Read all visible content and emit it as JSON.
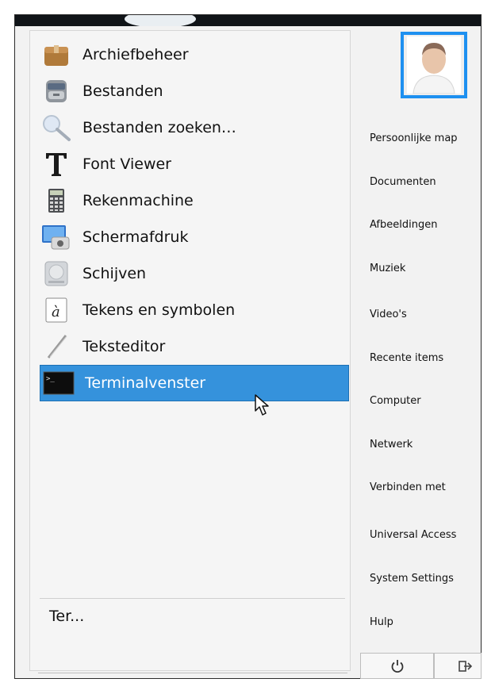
{
  "apps": [
    {
      "label": "Archiefbeheer",
      "icon": "archive-box-icon"
    },
    {
      "label": "Bestanden",
      "icon": "file-cabinet-icon"
    },
    {
      "label": "Bestanden zoeken…",
      "icon": "magnifier-icon"
    },
    {
      "label": "Font Viewer",
      "icon": "font-T-icon"
    },
    {
      "label": "Rekenmachine",
      "icon": "calculator-icon"
    },
    {
      "label": "Schermafdruk",
      "icon": "screenshot-icon"
    },
    {
      "label": "Schijven",
      "icon": "disk-icon"
    },
    {
      "label": "Tekens en symbolen",
      "icon": "character-map-icon"
    },
    {
      "label": "Teksteditor",
      "icon": "text-editor-icon"
    },
    {
      "label": "Terminalvenster",
      "icon": "terminal-icon",
      "selected": true
    }
  ],
  "search": {
    "value": "Ter..."
  },
  "places": [
    "Persoonlijke map",
    "Documenten",
    "Afbeeldingen",
    "Muziek",
    "Video's",
    "Recente items",
    "Computer",
    "Netwerk",
    "Verbinden met",
    "Universal Access",
    "System Settings",
    "Hulp"
  ],
  "session": {
    "power_icon": "power-icon",
    "logout_icon": "logout-icon"
  },
  "colors": {
    "accent": "#3592dc",
    "avatar_border": "#1e90f0"
  }
}
